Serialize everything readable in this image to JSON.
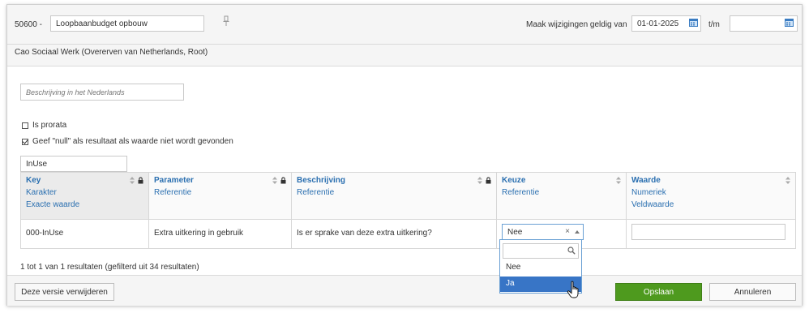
{
  "header": {
    "code": "50600 -",
    "name_value": "Loopbaanbudget opbouw",
    "valid_label": "Maak wijzigingen geldig van",
    "date_from": "01-01-2025",
    "tm_label": "t/m",
    "date_to": ""
  },
  "subtitle": "Cao Sociaal Werk (Overerven van Netherlands, Root)",
  "form": {
    "description_placeholder": "Beschrijving in het Nederlands",
    "prorata_label": "Is prorata",
    "null_label": "Geef \"null\" als resultaat als waarde niet wordt gevonden",
    "filter_value": "InUse"
  },
  "table": {
    "columns": [
      {
        "title": "Key",
        "sub1": "Karakter",
        "sub2": "Exacte waarde"
      },
      {
        "title": "Parameter",
        "sub1": "Referentie",
        "sub2": ""
      },
      {
        "title": "Beschrijving",
        "sub1": "Referentie",
        "sub2": ""
      },
      {
        "title": "Keuze",
        "sub1": "Referentie",
        "sub2": ""
      },
      {
        "title": "Waarde",
        "sub1": "Numeriek",
        "sub2": "Veldwaarde"
      }
    ],
    "rows": [
      {
        "key": "000-InUse",
        "parameter": "Extra uitkering in gebruik",
        "description": "Is er sprake van deze extra uitkering?",
        "choice": "Nee",
        "value": ""
      }
    ]
  },
  "results_text": "1 tot 1 van 1 resultaten (gefilterd uit 34 resultaten)",
  "dropdown": {
    "clear_symbol": "×",
    "options": [
      "Nee",
      "Ja"
    ],
    "highlighted": "Ja"
  },
  "footer": {
    "delete_label": "Deze versie verwijderen",
    "save_label": "Opslaan",
    "cancel_label": "Annuleren"
  },
  "colors": {
    "link_blue": "#2a6fb0",
    "save_green": "#4e9a1e",
    "highlight_blue": "#3875c6"
  }
}
